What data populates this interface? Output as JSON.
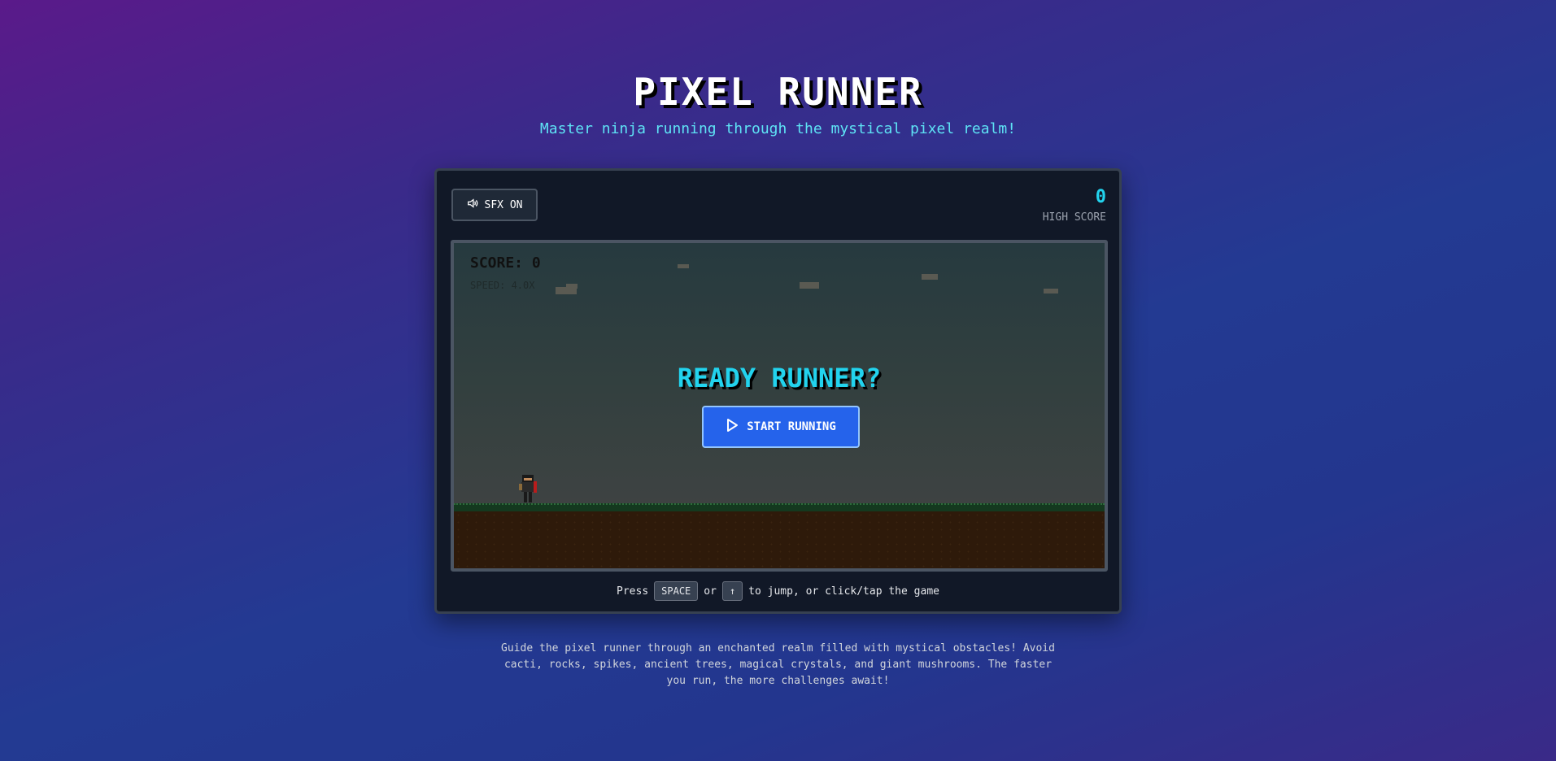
{
  "header": {
    "title": "PIXEL RUNNER",
    "subtitle": "Master ninja running through the mystical pixel realm!"
  },
  "toolbar": {
    "sfx_label": "SFX ON",
    "sfx_icon": "speaker-icon"
  },
  "high_score": {
    "value": "0",
    "label": "HIGH SCORE"
  },
  "game": {
    "score_text": "SCORE: 0",
    "speed_text": "SPEED: 4.0X",
    "ready_text": "READY RUNNER?",
    "start_label": "START RUNNING",
    "start_icon": "play-icon"
  },
  "help": {
    "press": "Press",
    "key_space": "SPACE",
    "or": "or",
    "key_up": "↑",
    "rest": "to jump, or click/tap the game"
  },
  "description": "Guide the pixel runner through an enchanted realm filled with mystical obstacles! Avoid cacti, rocks, spikes, ancient trees, magical crystals, and giant mushrooms. The faster you run, the more challenges await!",
  "colors": {
    "accent": "#22d3ee",
    "button": "#2563eb",
    "panel": "#111827"
  }
}
